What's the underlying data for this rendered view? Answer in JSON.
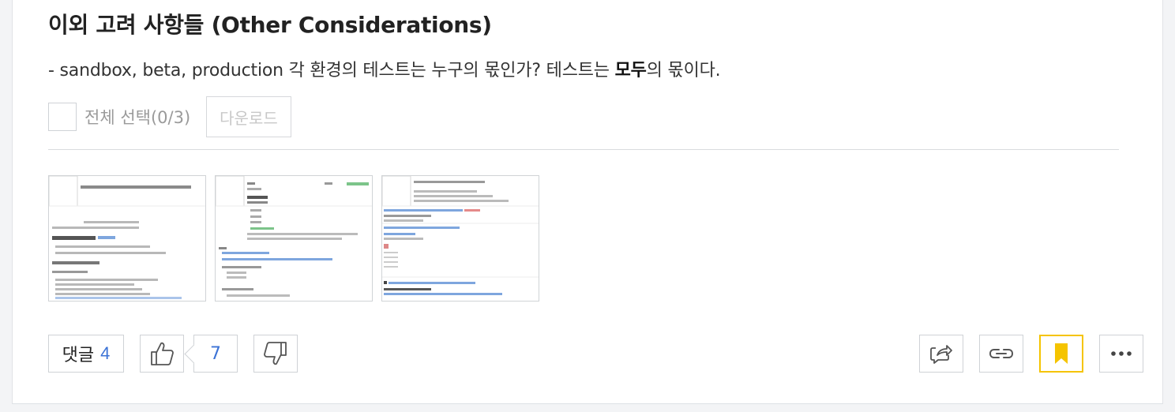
{
  "post": {
    "title": "이외 고려 사항들 (Other Considerations)",
    "desc_before": "- sandbox, beta, production 각 환경의 테스트는 누구의 몫인가? 테스트는 ",
    "desc_bold": "모두",
    "desc_after": "의 몫이다."
  },
  "attachments": {
    "select_all_label": "전체 선택(0/3)",
    "download_label": "다운로드",
    "thumbnails": [
      {
        "alt": "attachment-1"
      },
      {
        "alt": "attachment-2"
      },
      {
        "alt": "attachment-3"
      }
    ]
  },
  "footer": {
    "comment_label": "댓글",
    "comment_count": "4",
    "like_count": "7"
  },
  "icons": {
    "like": "thumbs-up-icon",
    "dislike": "thumbs-down-icon",
    "share": "share-icon",
    "link": "link-icon",
    "bookmark": "bookmark-icon",
    "more": "more-icon"
  },
  "colors": {
    "accent_blue": "#3c73d6",
    "bookmark_yellow": "#f5c400"
  }
}
